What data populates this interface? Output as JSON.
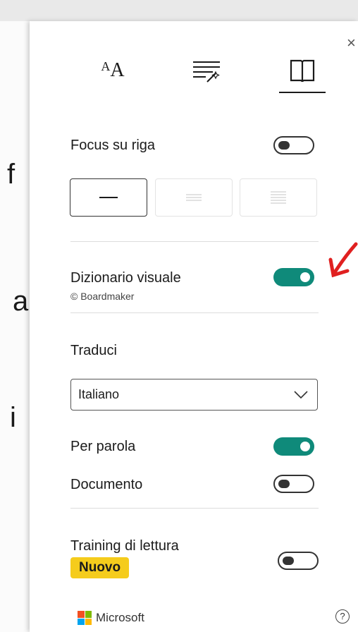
{
  "background": {
    "letters": [
      "f",
      "a",
      "i"
    ]
  },
  "panel": {
    "close_glyph": "×",
    "tabs": [
      {
        "name": "text-size-tab",
        "icon": "text-size-icon",
        "glyph": "AA"
      },
      {
        "name": "text-options-tab",
        "icon": "text-options-icon"
      },
      {
        "name": "reading-preferences-tab",
        "icon": "book-icon",
        "active": true
      }
    ],
    "line_focus": {
      "label": "Focus su riga",
      "enabled": false
    },
    "picture_dictionary": {
      "label": "Dizionario visuale",
      "sublabel": "© Boardmaker",
      "enabled": true
    },
    "translate": {
      "heading": "Traduci",
      "language": "Italiano",
      "by_word": {
        "label": "Per parola",
        "enabled": true
      },
      "document": {
        "label": "Documento",
        "enabled": false
      }
    },
    "reading_coach": {
      "label": "Training di lettura",
      "badge": "Nuovo",
      "enabled": false
    },
    "footer": {
      "brand": "Microsoft",
      "help": "?"
    },
    "colors": {
      "accent": "#0f8a7a",
      "badge": "#f5cc1c",
      "annotation": "#e02020"
    }
  }
}
